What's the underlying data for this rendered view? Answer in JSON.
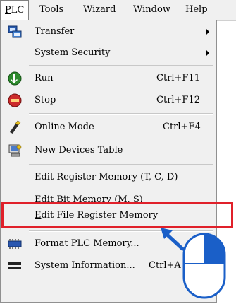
{
  "menubar": {
    "items": [
      {
        "label": "PLC",
        "u": "P",
        "rest": "LC"
      },
      {
        "label": "Tools",
        "u": "T",
        "rest": "ools"
      },
      {
        "label": "Wizard",
        "u": "W",
        "rest": "izard"
      },
      {
        "label": "Window",
        "u": "W",
        "rest": "indow"
      },
      {
        "label": "Help",
        "u": "H",
        "rest": "elp"
      }
    ]
  },
  "menu": {
    "transfer": "Transfer",
    "system_security": "System Security",
    "run": "Run",
    "run_shortcut": "Ctrl+F11",
    "stop": "Stop",
    "stop_shortcut": "Ctrl+F12",
    "online_mode": "Online Mode",
    "online_mode_shortcut": "Ctrl+F4",
    "new_devices_table": "New Devices Table",
    "edit_register_memory": "Edit Register Memory (T, C, D)",
    "edit_bit_pre": "Edit Bit ",
    "edit_bit_u": "M",
    "edit_bit_post": "emory (M, S)",
    "edit_file_u": "E",
    "edit_file_rest": "dit File Register Memory",
    "format_plc_memory": "Format PLC Memory...",
    "system_information": "System Information...",
    "system_information_shortcut": "Ctrl+A"
  },
  "colors": {
    "highlight": "#e0202a",
    "arrow": "#1a5fc8"
  }
}
